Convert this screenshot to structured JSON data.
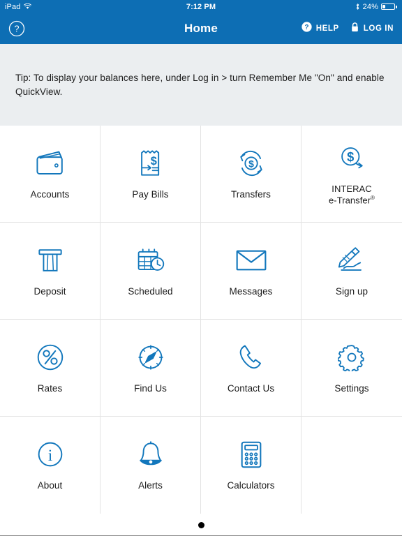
{
  "status_bar": {
    "device": "iPad",
    "wifi_icon": "wifi-icon",
    "time": "7:12 PM",
    "bluetooth_icon": "bluetooth-icon",
    "battery_percent": "24%",
    "battery_icon": "battery-icon"
  },
  "nav": {
    "help_circle_icon": "question-circle-icon",
    "title": "Home",
    "help_label": "HELP",
    "help_icon": "question-mark-badge-icon",
    "login_label": "LOG IN",
    "lock_icon": "lock-icon"
  },
  "tip": {
    "text": "Tip: To display your balances here, under Log in > turn Remember Me \"On\" and enable QuickView."
  },
  "grid": {
    "items": [
      {
        "label": "Accounts",
        "icon": "wallet-icon"
      },
      {
        "label": "Pay Bills",
        "icon": "bill-dollar-icon"
      },
      {
        "label": "Transfers",
        "icon": "transfer-arrows-dollar-icon"
      },
      {
        "label": "INTERAC\ne-Transfer®",
        "label_line1": "INTERAC",
        "label_line2": "e-Transfer",
        "label_sup": "®",
        "icon": "interac-dollar-circle-arrow-icon"
      },
      {
        "label": "Deposit",
        "icon": "deposit-slot-icon"
      },
      {
        "label": "Scheduled",
        "icon": "calendar-clock-icon"
      },
      {
        "label": "Messages",
        "icon": "envelope-icon"
      },
      {
        "label": "Sign up",
        "icon": "pen-signature-icon"
      },
      {
        "label": "Rates",
        "icon": "percent-circle-icon"
      },
      {
        "label": "Find Us",
        "icon": "compass-icon"
      },
      {
        "label": "Contact Us",
        "icon": "phone-handset-icon"
      },
      {
        "label": "Settings",
        "icon": "gear-icon"
      },
      {
        "label": "About",
        "icon": "info-circle-icon"
      },
      {
        "label": "Alerts",
        "icon": "bell-icon"
      },
      {
        "label": "Calculators",
        "icon": "calculator-icon"
      }
    ]
  },
  "pager": {
    "pages": 1,
    "current": 1
  },
  "colors": {
    "brand_blue": "#0d6eb4",
    "icon_blue": "#1277bc",
    "tip_background": "#ebeef0",
    "grid_line": "#e3e3e3",
    "text": "#1c1c1c"
  }
}
